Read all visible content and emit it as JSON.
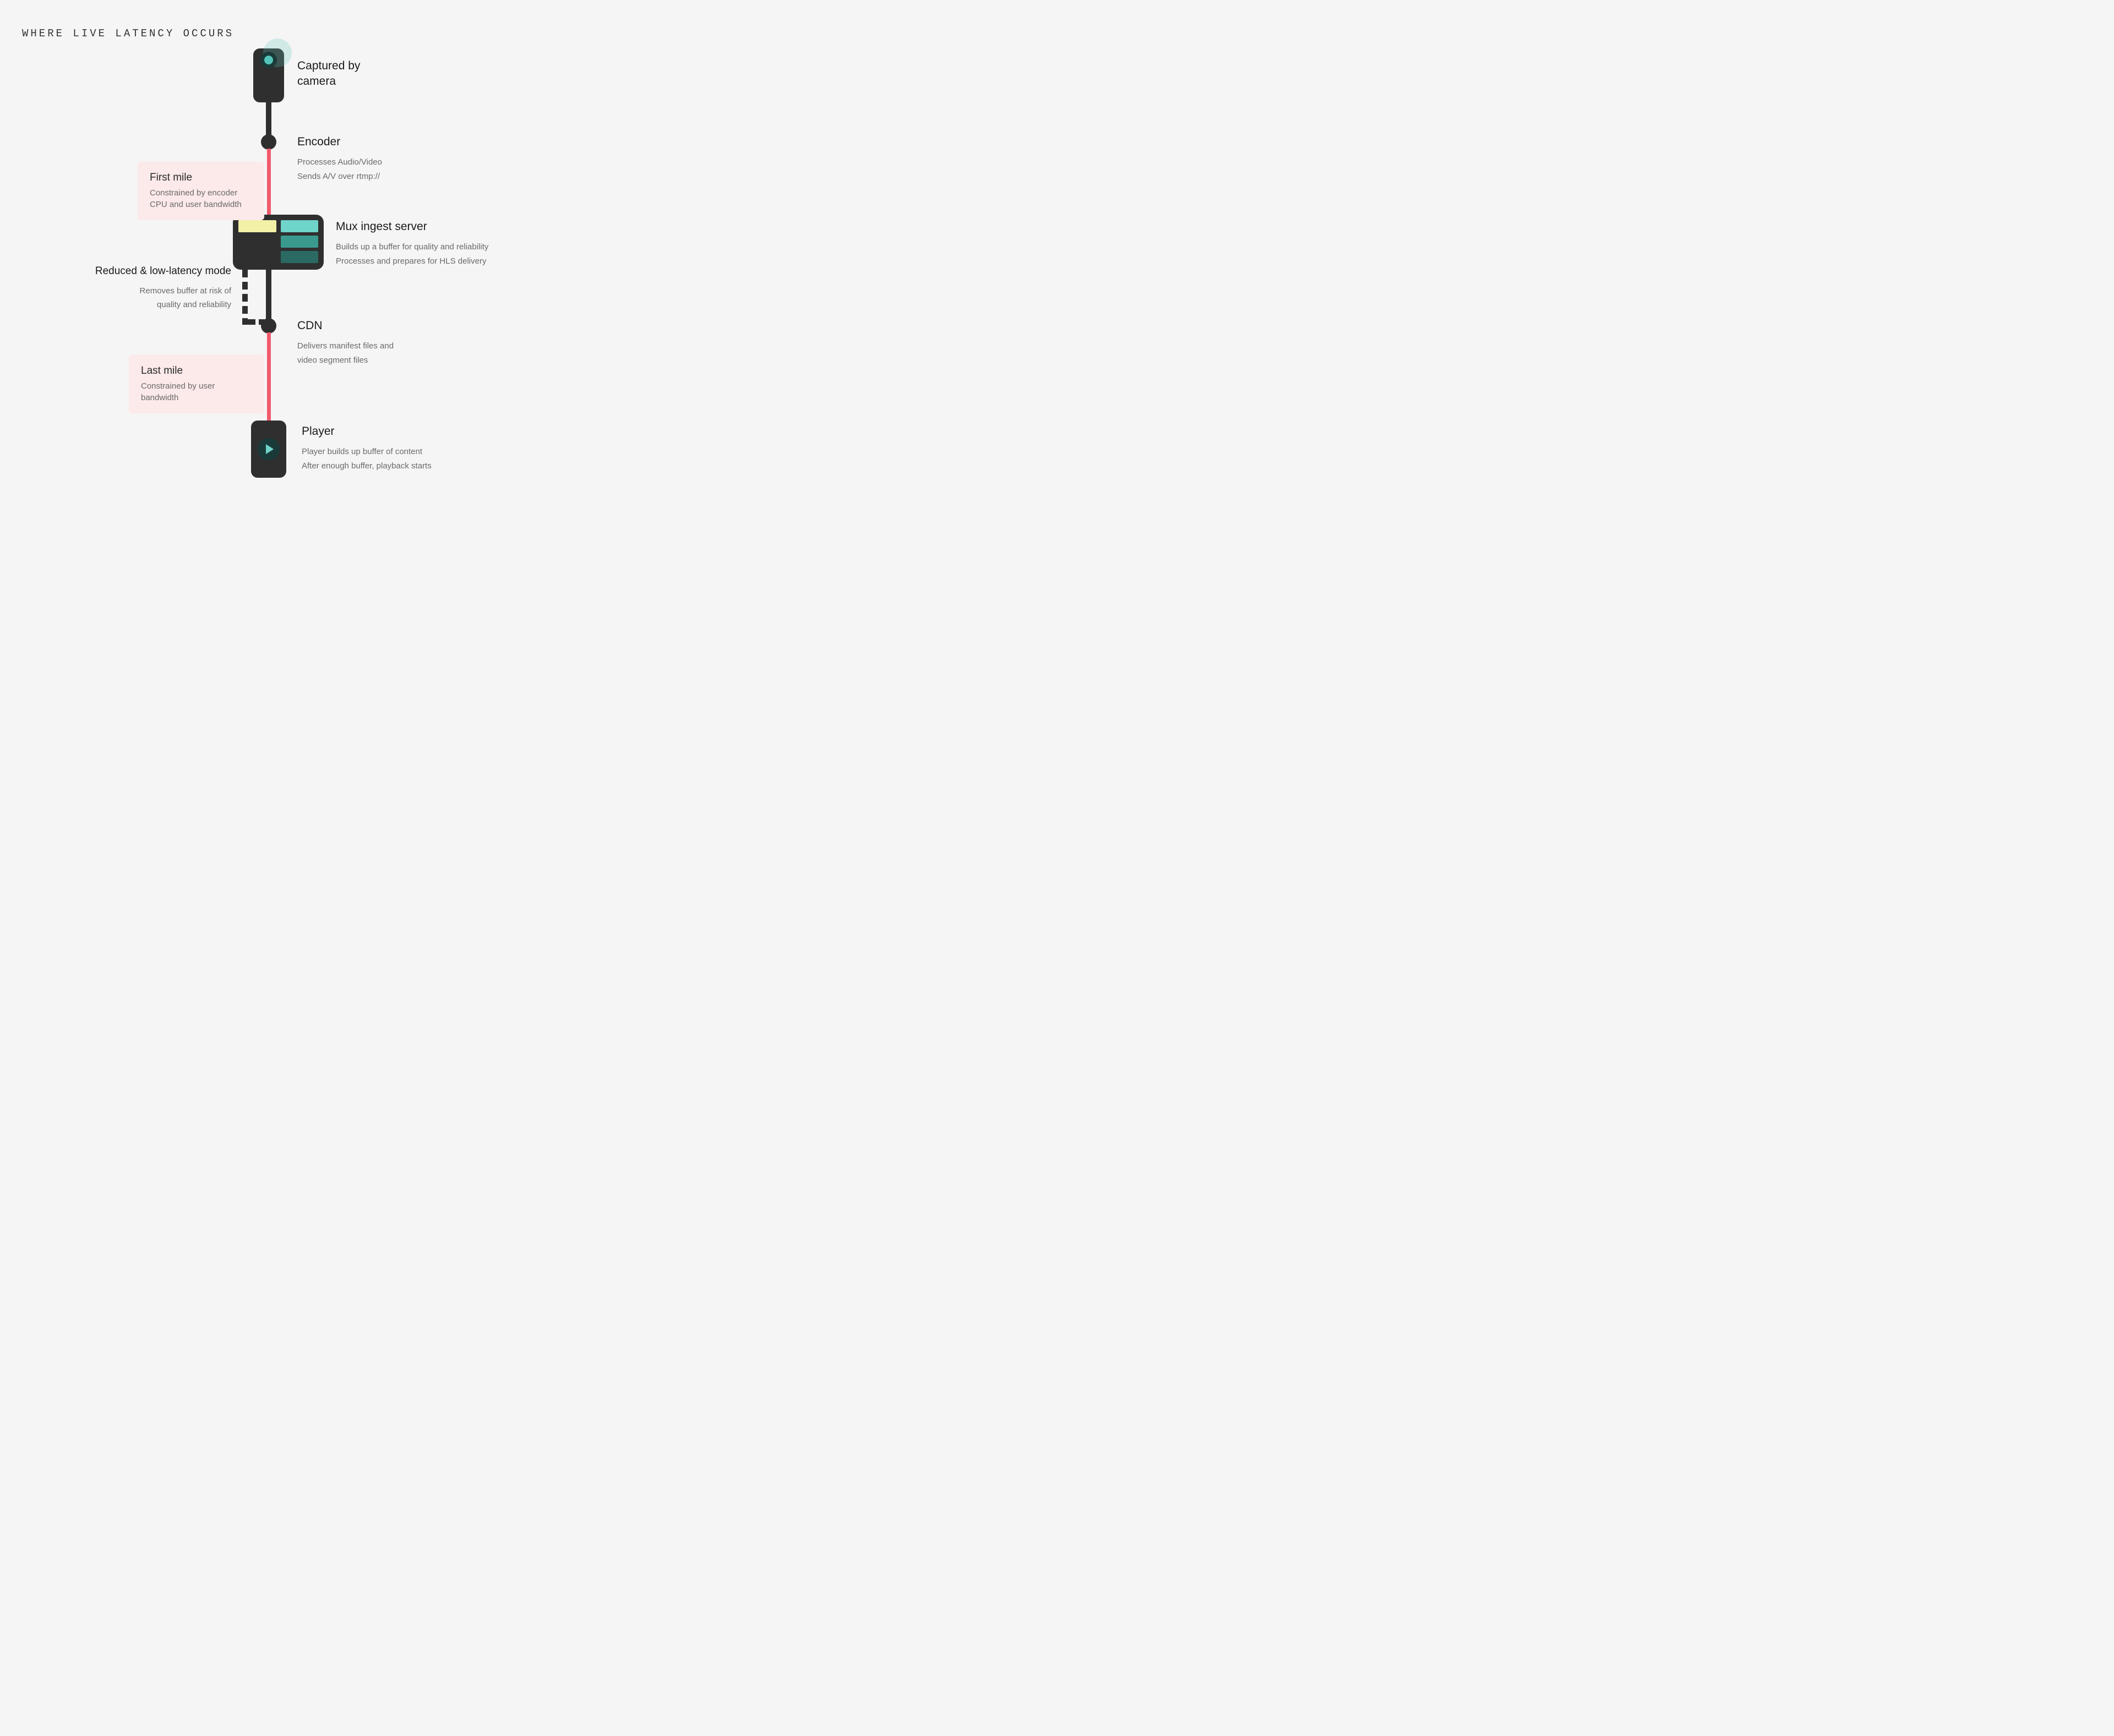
{
  "title": "WHERE LIVE LATENCY OCCURS",
  "nodes": {
    "camera": {
      "title": "Captured by\ncamera"
    },
    "encoder": {
      "title": "Encoder",
      "desc": "Processes Audio/Video\nSends A/V over rtmp://"
    },
    "server": {
      "title": "Mux ingest server",
      "desc": "Builds up a buffer for quality and reliability\nProcesses and prepares for HLS delivery"
    },
    "cdn": {
      "title": "CDN",
      "desc": "Delivers manifest files and\nvideo segment files"
    },
    "player": {
      "title": "Player",
      "desc": "Player builds up buffer of content\nAfter enough buffer, playback starts"
    }
  },
  "callouts": {
    "firstMile": {
      "title": "First mile",
      "desc": "Constrained by encoder CPU and user bandwidth"
    },
    "reduced": {
      "title": "Reduced & low-latency mode",
      "desc": "Removes buffer at risk of\nquality and reliability"
    },
    "lastMile": {
      "title": "Last mile",
      "desc": "Constrained by user bandwidth"
    }
  },
  "colors": {
    "bg": "#f5f5f5",
    "dark": "#2f2f2f",
    "red": "#f15a6c",
    "pink": "#fce9e9",
    "teal": "#6fd4c9"
  }
}
